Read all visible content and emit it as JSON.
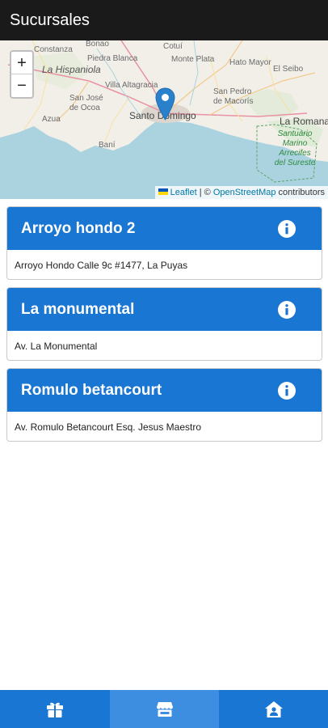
{
  "app": {
    "title": "Sucursales"
  },
  "map": {
    "zoom_in": "+",
    "zoom_out": "−",
    "labels": {
      "bonao": "Bonao",
      "constanza": "Constanza",
      "piedra_blanca": "Piedra Blanca",
      "la_hispaniola": "La Hispaniola",
      "villa_altagracia": "Villa Altagracia",
      "san_jose_de_ocoa_1": "San José",
      "san_jose_de_ocoa_2": "de Ocoa",
      "azua": "Azua",
      "bani": "Baní",
      "santo_domingo": "Santo Domingo",
      "cotui": "Cotuí",
      "monte_plata": "Monte Plata",
      "hato_mayor": "Hato Mayor",
      "el_seibo": "El Seibo",
      "san_pedro_1": "San Pedro",
      "san_pedro_2": "de Macorís",
      "la_romana": "La Romana",
      "park_1": "Santuario",
      "park_2": "Marino",
      "park_3": "Arrecifes",
      "park_4": "del Sureste"
    },
    "attribution": {
      "leaflet": "Leaflet",
      "separator": " | © ",
      "osm": "OpenStreetMap",
      "contributors": " contributors"
    }
  },
  "branches": [
    {
      "name": "Arroyo hondo 2",
      "address": "Arroyo Hondo Calle 9c #1477, La Puyas"
    },
    {
      "name": "La monumental",
      "address": "Av. La Monumental"
    },
    {
      "name": "Romulo betancourt",
      "address": "Av. Romulo Betancourt Esq. Jesus Maestro"
    }
  ],
  "bottom_nav": [
    {
      "icon": "gift-icon",
      "active": false
    },
    {
      "icon": "store-icon",
      "active": true
    },
    {
      "icon": "home-user-icon",
      "active": false
    }
  ],
  "colors": {
    "appbar": "#1a1a1a",
    "primary": "#1976d2",
    "active_tab": "#3d8ee0",
    "sea": "#aad3df",
    "land": "#f2efe9"
  }
}
